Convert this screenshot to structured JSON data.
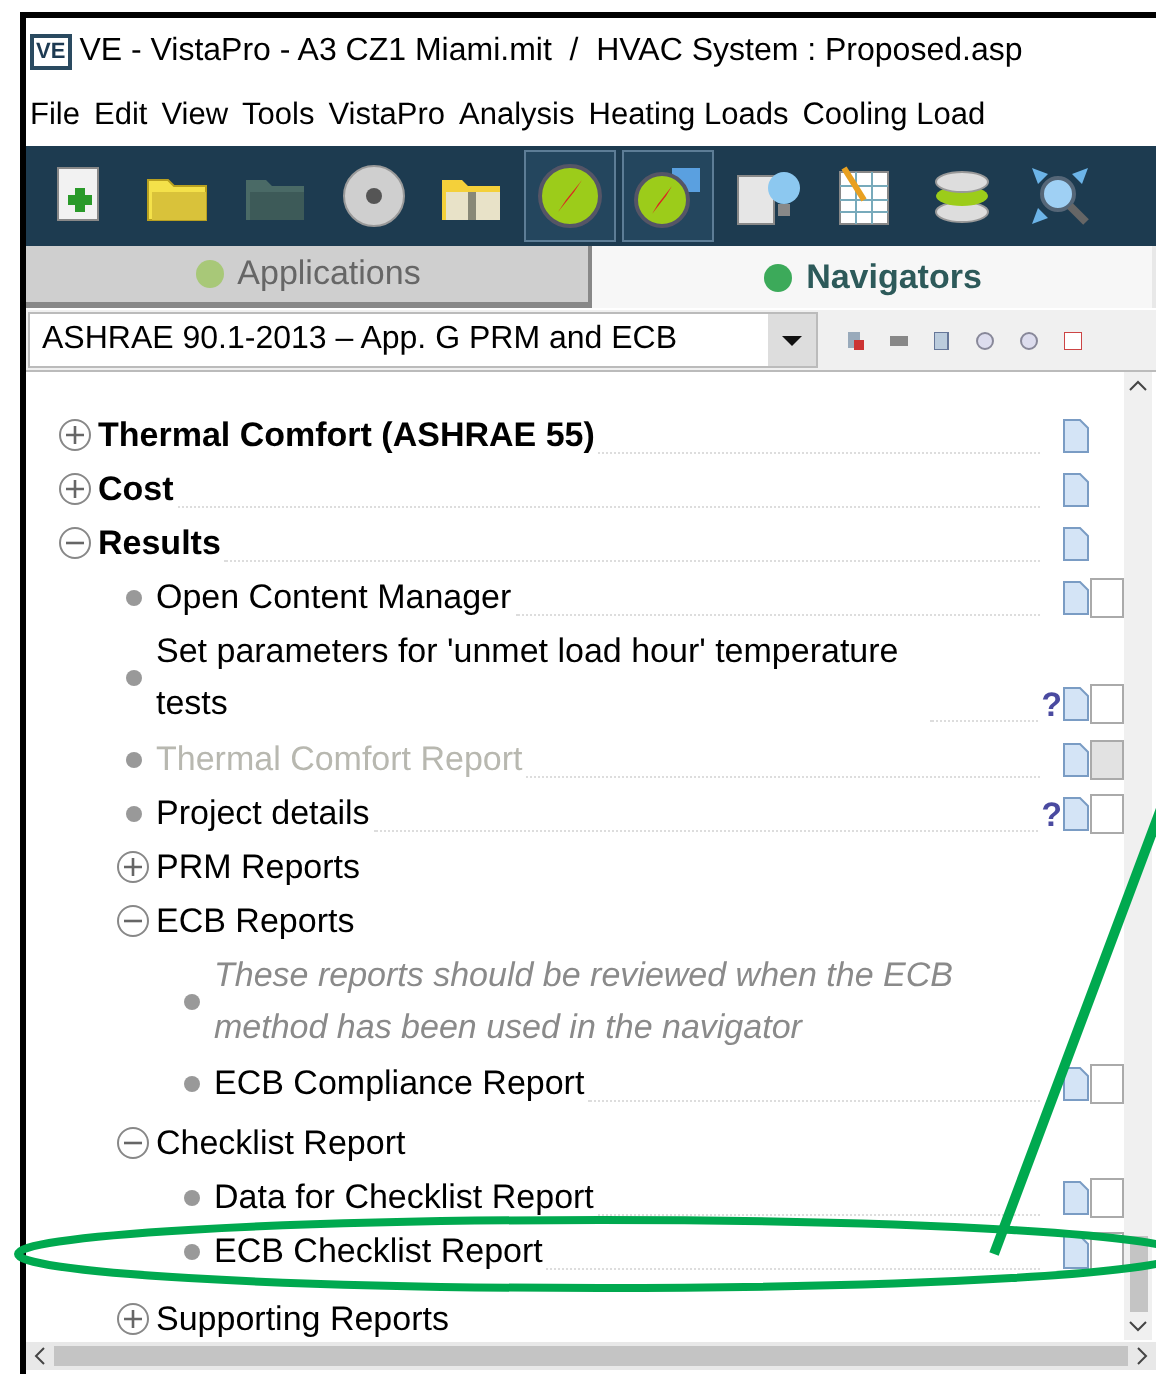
{
  "window": {
    "title": "VE - VistaPro - A3 CZ1 Miami.mit  /  HVAC System : Proposed.asp",
    "app_badge": "VE"
  },
  "menu": [
    "File",
    "Edit",
    "View",
    "Tools",
    "VistaPro",
    "Analysis",
    "Heating Loads",
    "Cooling Load"
  ],
  "toolbar": [
    {
      "kind": "new",
      "selected": false
    },
    {
      "kind": "open",
      "selected": false
    },
    {
      "kind": "folder-dim",
      "selected": false
    },
    {
      "kind": "disc",
      "selected": false
    },
    {
      "kind": "zip",
      "selected": false
    },
    {
      "kind": "compass",
      "selected": true
    },
    {
      "kind": "compass-grid",
      "selected": true
    },
    {
      "kind": "building",
      "selected": false
    },
    {
      "kind": "table",
      "selected": false
    },
    {
      "kind": "stack",
      "selected": false
    },
    {
      "kind": "zoom",
      "selected": false
    }
  ],
  "tabs": [
    {
      "label": "Applications",
      "selected": false
    },
    {
      "label": "Navigators",
      "selected": true
    }
  ],
  "navigator_select": {
    "value": "ASHRAE 90.1-2013 – App. G PRM and ECB"
  },
  "tree": [
    {
      "kind": "group",
      "label": "Thermal Comfort (ASHRAE 55)",
      "expanded": false
    },
    {
      "kind": "group",
      "label": "Cost",
      "expanded": false
    },
    {
      "kind": "group",
      "label": "Results",
      "expanded": true,
      "children": [
        {
          "kind": "item",
          "label": "Open Content Manager",
          "checked": false,
          "disabled": false
        },
        {
          "kind": "item",
          "label": "Set parameters for 'unmet load hour' temperature tests",
          "checked": false,
          "disabled": false,
          "help": "?"
        },
        {
          "kind": "item",
          "label": "Thermal Comfort Report",
          "checked": false,
          "disabled": true
        },
        {
          "kind": "item",
          "label": "Project details",
          "checked": false,
          "disabled": false,
          "help": "?"
        },
        {
          "kind": "subgroup",
          "label": "PRM Reports",
          "expanded": false
        },
        {
          "kind": "subgroup",
          "label": "ECB Reports",
          "expanded": true,
          "children": [
            {
              "kind": "note",
              "label": "These reports should be reviewed when the ECB method has been used in the navigator"
            },
            {
              "kind": "item",
              "label": "ECB Compliance Report",
              "checked": false,
              "disabled": false
            }
          ]
        },
        {
          "kind": "subgroup",
          "label": "Checklist Report",
          "expanded": true,
          "children": [
            {
              "kind": "item",
              "label": "Data for Checklist Report",
              "checked": false,
              "disabled": false
            },
            {
              "kind": "item",
              "label": "ECB Checklist Report",
              "checked": false,
              "disabled": false
            }
          ]
        },
        {
          "kind": "subgroup",
          "label": "Supporting Reports",
          "expanded": false
        }
      ]
    }
  ]
}
